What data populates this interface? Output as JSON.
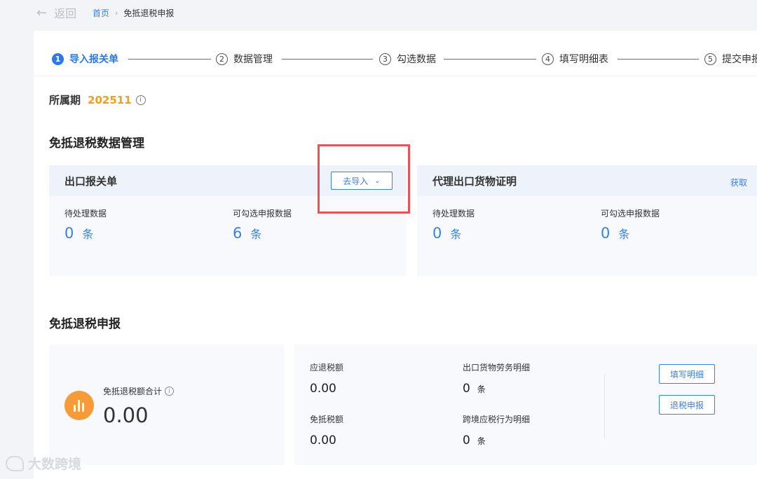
{
  "topbar": {
    "back_label": "返回",
    "breadcrumb_home": "首页",
    "breadcrumb_current": "免抵退税申报"
  },
  "steps": [
    {
      "num": "1",
      "label": "导入报关单"
    },
    {
      "num": "2",
      "label": "数据管理"
    },
    {
      "num": "3",
      "label": "勾选数据"
    },
    {
      "num": "4",
      "label": "填写明细表"
    },
    {
      "num": "5",
      "label": "提交申报"
    }
  ],
  "period": {
    "label": "所属期",
    "value": "202511"
  },
  "data_section": {
    "title": "免抵退税数据管理",
    "customs_card": {
      "title": "出口报关单",
      "import_button": "去导入",
      "pending_label": "待处理数据",
      "pending_value": "0",
      "pending_unit": "条",
      "selectable_label": "可勾选申报数据",
      "selectable_value": "6",
      "selectable_unit": "条"
    },
    "agent_card": {
      "title": "代理出口货物证明",
      "link": "获取",
      "pending_label": "待处理数据",
      "pending_value": "0",
      "pending_unit": "条",
      "selectable_label": "可勾选申报数据",
      "selectable_value": "0",
      "selectable_unit": "条"
    }
  },
  "declare_section": {
    "title": "免抵退税申报",
    "total_label": "免抵退税额合计",
    "total_value": "0.00",
    "refund_label": "应退税额",
    "refund_value": "0.00",
    "exempt_label": "免抵税额",
    "exempt_value": "0.00",
    "export_detail_label": "出口货物劳务明细",
    "export_detail_value": "0",
    "export_detail_unit": "条",
    "cross_border_label": "跨境应税行为明细",
    "cross_border_value": "0",
    "cross_border_unit": "条",
    "fill_button": "填写明细",
    "refund_button": "退税申报"
  },
  "watermark": "大数跨境",
  "colors": {
    "accent": "#3b7fe3",
    "period": "#f0a020",
    "highlight": "#e35656",
    "orb": "#f79a3a"
  }
}
